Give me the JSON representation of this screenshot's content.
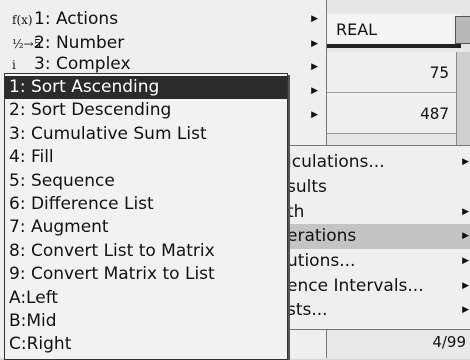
{
  "sheet": {
    "header": "REAL",
    "rows": [
      "75",
      "487"
    ],
    "status": "4/99"
  },
  "menu1": {
    "items": [
      {
        "icon": "f(x)",
        "label": "1: Actions"
      },
      {
        "icon": "½→5",
        "label": "2: Number"
      },
      {
        "icon": "i",
        "label": "3: Complex"
      }
    ]
  },
  "menu2": {
    "items": [
      {
        "label": "Calculations..."
      },
      {
        "label": "Results"
      },
      {
        "label": "Math"
      },
      {
        "label": "Operations"
      },
      {
        "label": "Solutions..."
      },
      {
        "label": "Confidence Intervals..."
      },
      {
        "label": "Tests..."
      }
    ]
  },
  "menu2_visible": [
    "lculations...",
    "sults",
    "th",
    "erations",
    "utions...",
    "ence Intervals...",
    "sts..."
  ],
  "menu3": {
    "items": [
      "1: Sort Ascending",
      "2: Sort Descending",
      "3: Cumulative Sum List",
      "4: Fill",
      "5: Sequence",
      "6: Difference List",
      "7: Augment",
      "8: Convert List to Matrix",
      "9: Convert Matrix to List",
      "A:Left",
      "B:Mid",
      "C:Right"
    ],
    "selected_index": 0
  },
  "colors": {
    "selected_bg": "#2b2b2b",
    "submenu_selected_bg": "#c4c4c4"
  }
}
